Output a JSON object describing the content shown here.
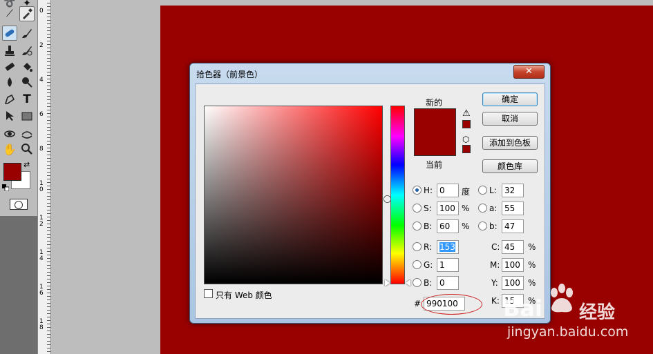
{
  "ruler": {
    "marks": [
      "0",
      "2",
      "4",
      "6",
      "8",
      "10",
      "12",
      "14",
      "16",
      "18"
    ]
  },
  "dialog": {
    "title": "拾色器（前景色）",
    "close_label": "✕",
    "buttons": {
      "ok": "确定",
      "cancel": "取消",
      "add_to_swatches": "添加到色板",
      "color_libraries": "颜色库"
    },
    "preview": {
      "new_label": "新的",
      "current_label": "当前",
      "new_color": "#990100",
      "current_color": "#990100"
    },
    "only_web_colors": {
      "label": "只有 Web 颜色",
      "checked": false
    },
    "fields": {
      "hsb": [
        {
          "label": "H:",
          "value": "0",
          "unit": "度",
          "checked": true
        },
        {
          "label": "S:",
          "value": "100",
          "unit": "%",
          "checked": false
        },
        {
          "label": "B:",
          "value": "60",
          "unit": "%",
          "checked": false
        }
      ],
      "rgb": [
        {
          "label": "R:",
          "value": "153",
          "checked": false
        },
        {
          "label": "G:",
          "value": "1",
          "checked": false
        },
        {
          "label": "B:",
          "value": "0",
          "checked": false
        }
      ],
      "lab": [
        {
          "label": "L:",
          "value": "32"
        },
        {
          "label": "a:",
          "value": "55"
        },
        {
          "label": "b:",
          "value": "47"
        }
      ],
      "cmyk": [
        {
          "label": "C:",
          "value": "45",
          "unit": "%"
        },
        {
          "label": "M:",
          "value": "100",
          "unit": "%"
        },
        {
          "label": "Y:",
          "value": "100",
          "unit": "%"
        },
        {
          "label": "K:",
          "value": "15",
          "unit": "%"
        }
      ],
      "hex": {
        "label": "#",
        "value": "990100"
      }
    }
  },
  "toolbox": {
    "foreground_color": "#990100",
    "background_color": "#ffffff"
  },
  "watermark": {
    "logo": "Bai",
    "name": "经验",
    "url": "jingyan.baidu.com"
  }
}
